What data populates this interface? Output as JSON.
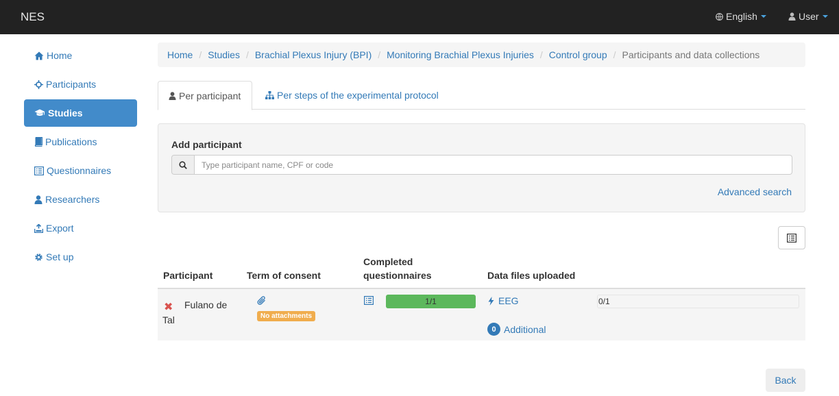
{
  "navbar": {
    "brand": "NES",
    "language": "English",
    "user": "User"
  },
  "sidebar": {
    "items": [
      {
        "label": "Home",
        "icon": "home-icon"
      },
      {
        "label": "Participants",
        "icon": "crosshair-icon"
      },
      {
        "label": "Studies",
        "icon": "graduation-cap-icon",
        "active": true
      },
      {
        "label": "Publications",
        "icon": "book-icon"
      },
      {
        "label": "Questionnaires",
        "icon": "list-alt-icon"
      },
      {
        "label": "Researchers",
        "icon": "user-icon"
      },
      {
        "label": "Export",
        "icon": "export-icon"
      },
      {
        "label": "Set up",
        "icon": "cog-icon"
      }
    ]
  },
  "breadcrumb": {
    "items": [
      "Home",
      "Studies",
      "Brachial Plexus Injury (BPI)",
      "Monitoring Brachial Plexus Injuries",
      "Control group"
    ],
    "current": "Participants and data collections"
  },
  "tabs": {
    "per_participant": "Per participant",
    "per_steps": "Per steps of the experimental protocol"
  },
  "add_participant": {
    "title": "Add participant",
    "placeholder": "Type participant name, CPF or code",
    "value": "",
    "advanced_search": "Advanced search"
  },
  "table": {
    "headers": {
      "participant": "Participant",
      "consent": "Term of consent",
      "questionnaires_line1": "Completed",
      "questionnaires_line2": "questionnaires",
      "files": "Data files uploaded"
    },
    "rows": [
      {
        "participant": "Fulano de Tal",
        "consent_badge": "No attachments",
        "questionnaires_progress": "1/1",
        "questionnaires_fraction": 1.0,
        "eeg_label": "EEG",
        "files_progress": "0/1",
        "files_fraction": 0.0,
        "additional_count": "0",
        "additional_label": "Additional"
      }
    ]
  },
  "actions": {
    "back": "Back"
  },
  "colors": {
    "navbar": "#222222",
    "link": "#337ab7",
    "active_nav": "#428bca",
    "success": "#5cb85c",
    "warning": "#f0ad4e",
    "danger": "#d9534f"
  }
}
